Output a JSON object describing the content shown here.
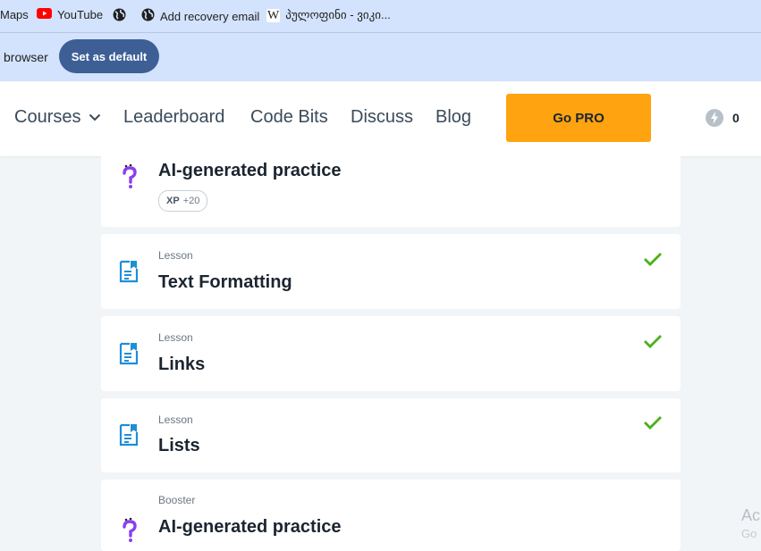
{
  "bookmarks": {
    "maps_label": "Maps",
    "youtube_label": "YouTube",
    "recovery_label": "Add recovery email",
    "wiki_label": "პულოფინი - ვიკი..."
  },
  "default_bar": {
    "text": "browser",
    "button_label": "Set as default"
  },
  "nav": {
    "courses_label": "Courses",
    "leaderboard_label": "Leaderboard",
    "codebits_label": "Code Bits",
    "discuss_label": "Discuss",
    "blog_label": "Blog",
    "gopro_label": "Go PRO",
    "bolt_count": "0"
  },
  "cards": {
    "c1": {
      "title": "AI-generated practice",
      "xp_label": "XP",
      "xp_value": "+20"
    },
    "c2": {
      "type": "Lesson",
      "title": "Text Formatting",
      "completed": true
    },
    "c3": {
      "type": "Lesson",
      "title": "Links",
      "completed": true
    },
    "c4": {
      "type": "Lesson",
      "title": "Lists",
      "completed": true
    },
    "c5": {
      "type": "Booster",
      "title": "AI-generated practice"
    }
  },
  "watermark": {
    "line1": "Ac",
    "line2": "Go"
  },
  "colors": {
    "accent_orange": "#ffa310",
    "check_green": "#4caf1a",
    "lesson_icon_blue": "#1e8fd6",
    "booster_icon_purple": "#8a3ff0",
    "button_blue": "#3d5f96"
  }
}
